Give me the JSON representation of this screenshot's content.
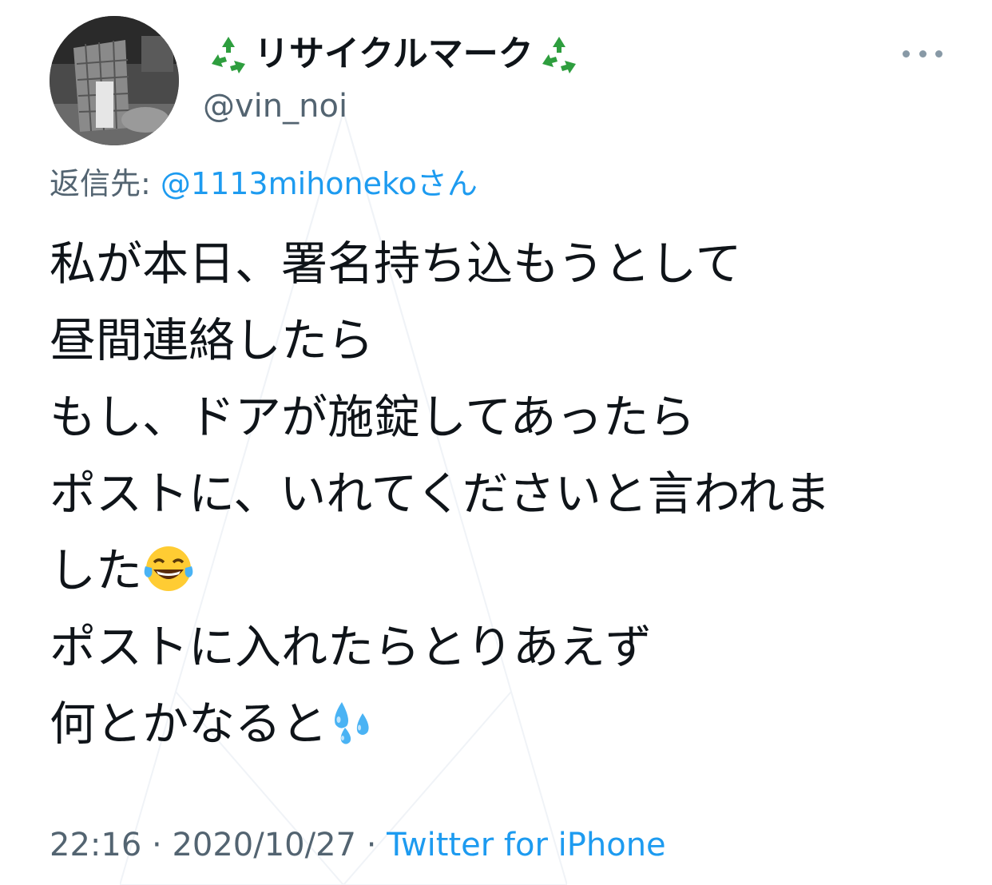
{
  "author": {
    "display_name": "リサイクルマーク",
    "display_name_icon": "recycle-icon",
    "handle": "@vin_noi",
    "avatar_description": "avatar"
  },
  "reply": {
    "prefix": "返信先:",
    "mention": "@1113mihonekoさん"
  },
  "body": {
    "lines": [
      "私が本日、署名持ち込もうとして",
      "昼間連絡したら",
      "もし、ドアが施錠してあったら",
      "ポストに、いれてくださいと言われま",
      "した",
      "ポストに入れたらとりあえず",
      "何とかなると"
    ],
    "emojis": {
      "line5": "tears-of-joy-emoji",
      "line7": "sweat-droplets-emoji"
    }
  },
  "meta": {
    "time": "22:16",
    "separator1": " · ",
    "date": "2020/10/27",
    "separator2": " · ",
    "source": "Twitter for iPhone"
  },
  "colors": {
    "text": "#0f1419",
    "secondary": "#536471",
    "link": "#1d9bf0",
    "recycle": "#2e9e3e"
  }
}
